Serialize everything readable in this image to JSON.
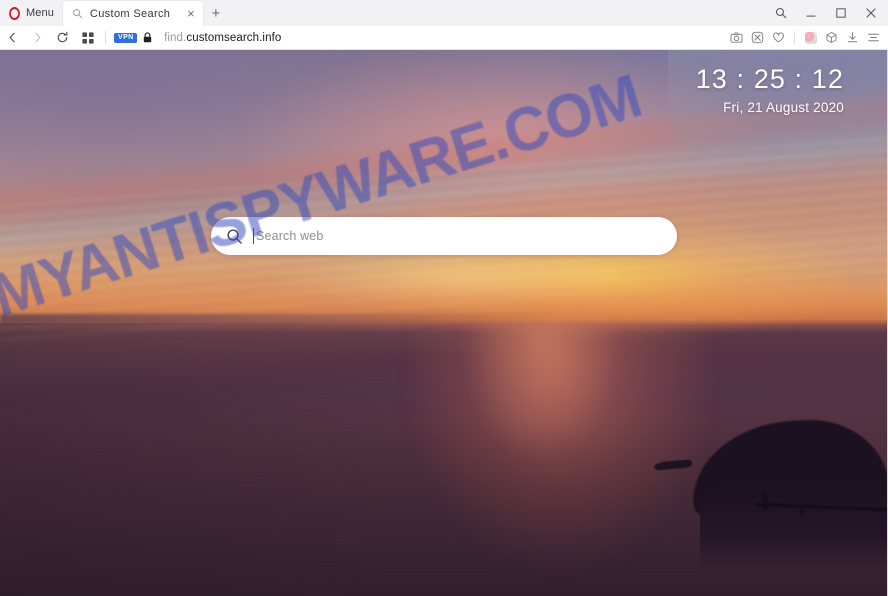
{
  "browser": {
    "menu_label": "Menu",
    "brand_icon": "opera-logo-icon",
    "tab": {
      "title": "Custom Search",
      "favicon": "search-icon",
      "close_label": "×"
    },
    "new_tab_label": "+",
    "window_controls": {
      "search": "search-icon",
      "minimize": "minimize-icon",
      "maximize": "maximize-icon",
      "close": "close-icon"
    },
    "navigation": {
      "back": "back-arrow-icon",
      "forward": "forward-arrow-icon",
      "reload": "reload-icon",
      "speed_dial": "speed-dial-grid-icon",
      "vpn_badge": "VPN",
      "site_security": "padlock-icon"
    },
    "address": {
      "subdomain": "find.",
      "domain": "customsearch.info",
      "full_url": "find.customsearch.info"
    },
    "toolbar_right": [
      {
        "name": "snapshot-icon",
        "label": "Snapshot"
      },
      {
        "name": "adblock-icon",
        "label": "Ad blocker"
      },
      {
        "name": "heart-icon",
        "label": "Add to favorites"
      },
      {
        "name": "opera-workspace-icon",
        "label": "Workspace"
      },
      {
        "name": "cube-icon",
        "label": "Extensions"
      },
      {
        "name": "download-icon",
        "label": "Downloads"
      },
      {
        "name": "easy-setup-icon",
        "label": "Easy setup"
      }
    ]
  },
  "page": {
    "clock": {
      "time": "13 : 25 : 12",
      "date": "Fri, 21 August 2020"
    },
    "search": {
      "placeholder": "Search web",
      "value": "",
      "icon": "search-icon"
    },
    "watermark": "MYANTISPYWARE.COM",
    "background": {
      "description": "sunset-over-sea-photo",
      "sky_top": "#7e7390",
      "sky_mid": "#c8937f",
      "sky_glow": "#ffd854",
      "horizon": "#c87c4a",
      "water": "#533246",
      "island": "#1c1120"
    }
  },
  "colors": {
    "accent_red": "#d6142e",
    "vpn_blue": "#2f6fdd",
    "watermark_blue": "#3a4ebe",
    "tab_active_bg": "#ffffff",
    "chrome_bg": "#f2f2f4"
  }
}
